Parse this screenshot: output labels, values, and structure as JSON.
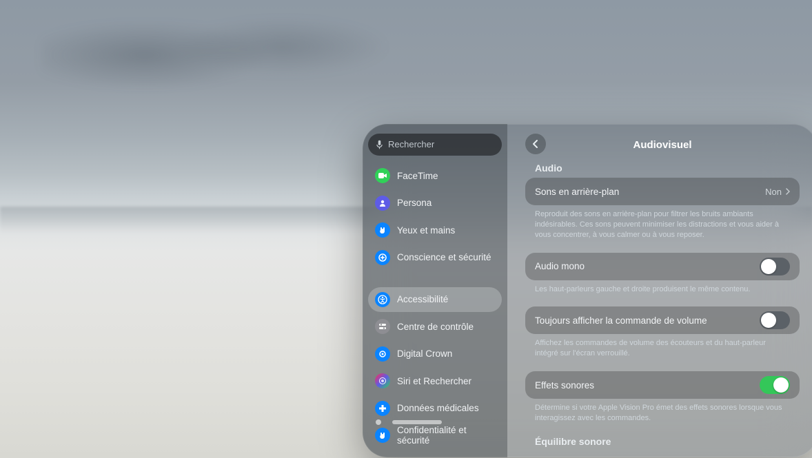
{
  "search": {
    "placeholder": "Rechercher"
  },
  "sidebar": {
    "items": [
      {
        "id": "facetime",
        "label": "FaceTime",
        "color": "#30d158",
        "iconGlyph": "▢"
      },
      {
        "id": "persona",
        "label": "Persona",
        "color": "#5e5ce6",
        "iconGlyph": "●"
      },
      {
        "id": "eyeshands",
        "label": "Yeux et mains",
        "color": "#0a84ff",
        "iconGlyph": "✋"
      },
      {
        "id": "awareness",
        "label": "Conscience et sécurité",
        "color": "#0a84ff",
        "iconGlyph": "✚"
      }
    ],
    "items2": [
      {
        "id": "accessibility",
        "label": "Accessibilité",
        "color": "#0a84ff",
        "iconGlyph": "➀",
        "selected": true
      },
      {
        "id": "controlcenter",
        "label": "Centre de contrôle",
        "color": "#8e8e93",
        "iconGlyph": "⌗"
      },
      {
        "id": "digitalcrown",
        "label": "Digital Crown",
        "color": "#0a84ff",
        "iconGlyph": "◎"
      },
      {
        "id": "siri",
        "label": "Siri et Rechercher",
        "color": "#ff2d55",
        "iconGlyph": "◉"
      },
      {
        "id": "medical",
        "label": "Données médicales",
        "color": "#0a84ff",
        "iconGlyph": "✚"
      },
      {
        "id": "privacy",
        "label": "Confidentialité et sécurité",
        "color": "#0a84ff",
        "iconGlyph": "✋"
      }
    ]
  },
  "header": {
    "title": "Audiovisuel"
  },
  "sections": {
    "audio_label": "Audio",
    "equilibre_label": "Équilibre sonore",
    "background_sounds": {
      "label": "Sons en arrière-plan",
      "value": "Non",
      "desc": "Reproduit des sons en arrière-plan pour filtrer les bruits ambiants indésirables. Ces sons peuvent minimiser les distractions et vous aider à vous concentrer, à vous calmer ou à vous reposer."
    },
    "mono": {
      "label": "Audio mono",
      "on": false,
      "desc": "Les haut-parleurs gauche et droite produisent le même contenu."
    },
    "volume": {
      "label": "Toujours afficher la commande de volume",
      "on": false,
      "desc": "Affichez les commandes de volume des écouteurs et du haut-parleur intégré sur l'écran verrouillé."
    },
    "effects": {
      "label": "Effets sonores",
      "on": true,
      "desc": "Détermine si votre Apple Vision Pro émet des effets sonores lorsque vous interagissez avec les commandes."
    }
  }
}
